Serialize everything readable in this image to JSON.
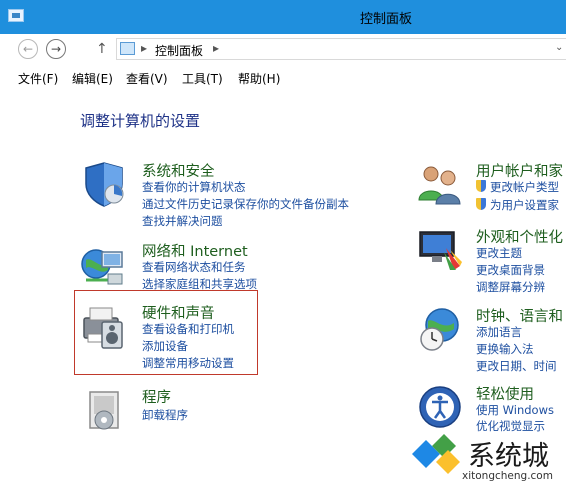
{
  "window": {
    "title": "控制面板"
  },
  "address": {
    "crumb": "控制面板",
    "separator": "▸",
    "up": "↑",
    "back": "←",
    "forward": "→",
    "dropdown": "⌄"
  },
  "menu": [
    "文件(F)",
    "编辑(E)",
    "查看(V)",
    "工具(T)",
    "帮助(H)"
  ],
  "heading": "调整计算机的设置",
  "categories_left": [
    {
      "icon": "system-security-icon",
      "title": "系统和安全",
      "links": [
        "查看你的计算机状态",
        "通过文件历史记录保存你的文件备份副本",
        "查找并解决问题"
      ]
    },
    {
      "icon": "network-icon",
      "title": "网络和 Internet",
      "links": [
        "查看网络状态和任务",
        "选择家庭组和共享选项"
      ]
    },
    {
      "icon": "hardware-sound-icon",
      "title": "硬件和声音",
      "links": [
        "查看设备和打印机",
        "添加设备",
        "调整常用移动设置"
      ]
    },
    {
      "icon": "programs-icon",
      "title": "程序",
      "links": [
        "卸载程序"
      ]
    }
  ],
  "categories_right": [
    {
      "icon": "user-accounts-icon",
      "title": "用户帐户和家",
      "links": [
        "更改帐户类型",
        "为用户设置家"
      ]
    },
    {
      "icon": "appearance-icon",
      "title": "外观和个性化",
      "links": [
        "更改主题",
        "更改桌面背景",
        "调整屏幕分辨"
      ]
    },
    {
      "icon": "clock-language-icon",
      "title": "时钟、语言和",
      "links": [
        "添加语言",
        "更换输入法",
        "更改日期、时间"
      ]
    },
    {
      "icon": "ease-of-access-icon",
      "title": "轻松使用",
      "links": [
        "使用 Windows",
        "优化视觉显示"
      ]
    }
  ],
  "watermark": {
    "text": "系统城",
    "url": "xitongcheng.com"
  },
  "colors": {
    "titlebar": "#1f8fdd",
    "link": "#1e4fa0",
    "category_title": "#1e5e1e",
    "highlight_box": "#c0392b"
  }
}
